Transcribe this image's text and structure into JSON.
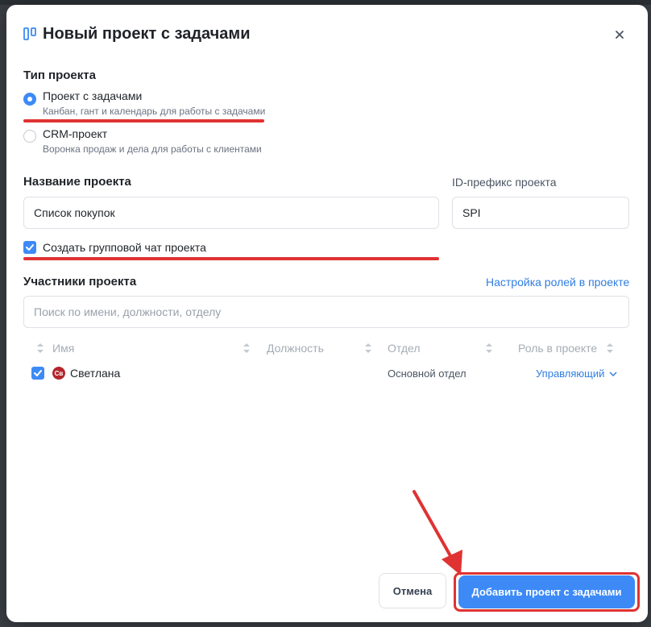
{
  "modal": {
    "title": "Новый проект с задачами",
    "close_icon": "close-icon"
  },
  "project_type": {
    "label": "Тип проекта",
    "options": [
      {
        "title": "Проект с задачами",
        "description": "Канбан, гант и календарь для работы с задачами",
        "selected": true
      },
      {
        "title": "CRM-проект",
        "description": "Воронка продаж и дела для работы с клиентами",
        "selected": false
      }
    ]
  },
  "project_name": {
    "label": "Название проекта",
    "value": "Список покупок"
  },
  "id_prefix": {
    "label": "ID-префикс проекта",
    "value": "SPI"
  },
  "group_chat": {
    "label": "Создать групповой чат проекта",
    "checked": true
  },
  "members": {
    "label": "Участники проекта",
    "roles_link": "Настройка ролей в проекте",
    "search_placeholder": "Поиск по имени, должности, отделу",
    "columns": [
      "Имя",
      "Должность",
      "Отдел",
      "Роль в проекте"
    ],
    "rows": [
      {
        "avatar": "Св",
        "name": "Светлана",
        "position": "",
        "department": "Основной отдел",
        "role": "Управляющий",
        "checked": true
      }
    ]
  },
  "footer": {
    "cancel_label": "Отмена",
    "submit_label": "Добавить проект с задачами"
  },
  "colors": {
    "accent": "#3d8af7",
    "link": "#2f7de1",
    "annotation": "#e03232"
  }
}
